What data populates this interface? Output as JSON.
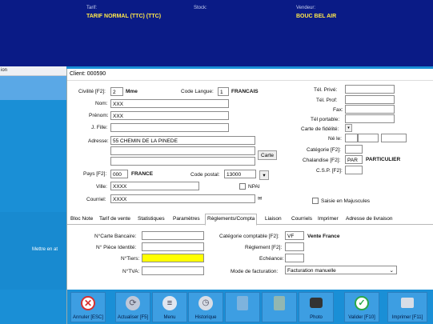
{
  "banner": {
    "tarif_label": "Tarif:",
    "tarif_value": "TARIF NORMAL (TTC) (TTC)",
    "stock_label": "Stock:",
    "vendeur_label": "Vendeur:",
    "vendeur_value": "BOUC BEL AIR"
  },
  "left": {
    "header_fragment": "ion",
    "mettre_text": "Mettre en at"
  },
  "dialog": {
    "title": "Client: 000590",
    "civilite": {
      "label": "Civilité [F2]:",
      "code": "2",
      "value": "Mme"
    },
    "code_langue": {
      "label": "Code Langue:",
      "code": "1",
      "value": "FRANCAIS"
    },
    "nom": {
      "label": "Nom:",
      "value": "XXX"
    },
    "prenom": {
      "label": "Prénom:",
      "value": "XXX"
    },
    "jfille": {
      "label": "J. Fille:",
      "value": ""
    },
    "adresse": {
      "label": "Adresse:",
      "line1": "55 CHEMIN DE LA PINEDE",
      "line2": "",
      "line3": ""
    },
    "carte_button": "Carte",
    "pays": {
      "label": "Pays [F2]:",
      "code": "000",
      "value": "FRANCE"
    },
    "code_postal": {
      "label": "Code postal:",
      "value": "13000"
    },
    "code_postal_btn": "▾",
    "ville": {
      "label": "Ville:",
      "value": "XXXX"
    },
    "npai_label": "NPAI",
    "courriel": {
      "label": "Courriel:",
      "value": "XXXX"
    },
    "tel_prive": "Tél. Privé:",
    "tel_prof": "Tél. Prof:",
    "fax": "Fax:",
    "tel_portable": "Tél portable:",
    "carte_fidelite": "Carte de fidélité:",
    "carte_fidelite_btn": "▾",
    "ne_le": "Né le:",
    "categorie": "Catégorie [F2]:",
    "chalandise": {
      "label": "Chalandise [F2]:",
      "code": "PAR",
      "value": "PARTICULIER"
    },
    "csp": "C.S.P. [F2]:",
    "saisie_label": "Saisie en Majuscules",
    "tabs": [
      "Bloc Note",
      "Tarif de vente",
      "Statistiques",
      "Paramètres",
      "Règlements/Compta",
      "Liaison",
      "Courriels",
      "Imprimer",
      "Adresse de livraison"
    ],
    "reg": {
      "carte_bancaire": "N°Carte Bancaire:",
      "piece_identite": "N° Pièce Identité:",
      "tiers": "N°Tiers:",
      "tva": "N°TVA:",
      "cat_comptable": "Catégorie comptable [F2]:",
      "cat_code": "VF",
      "cat_value": "Vente France",
      "reglement": "Règlement [F2]:",
      "echeance": "Echéance:",
      "mode_fact": "Mode de facturation:",
      "mode_fact_value": "Facturation manuelle"
    }
  },
  "toolbar": [
    {
      "label": "Annuler [ESC]",
      "icon": "cancel-icon",
      "color": "#d83030",
      "enabled": true
    },
    {
      "label": "Actualiser [F5]",
      "icon": "refresh-icon",
      "color": "#c0c8d8",
      "enabled": true
    },
    {
      "label": "Menu",
      "icon": "menu-icon",
      "color": "#e0e6f0",
      "enabled": true
    },
    {
      "label": "Historique",
      "icon": "history-icon",
      "color": "#d8dde6",
      "enabled": true
    },
    {
      "label": "",
      "icon": "delete-icon",
      "color": "#c0c8d8",
      "enabled": false
    },
    {
      "label": "",
      "icon": "edit-icon",
      "color": "#e8d080",
      "enabled": false
    },
    {
      "label": "Photo",
      "icon": "camera-icon",
      "color": "#333333",
      "enabled": true
    },
    {
      "label": "Valider [F10]",
      "icon": "check-icon",
      "color": "#2aa84a",
      "enabled": true
    },
    {
      "label": "Imprimer [F11]",
      "icon": "printer-icon",
      "color": "#d8dde6",
      "enabled": true
    }
  ]
}
